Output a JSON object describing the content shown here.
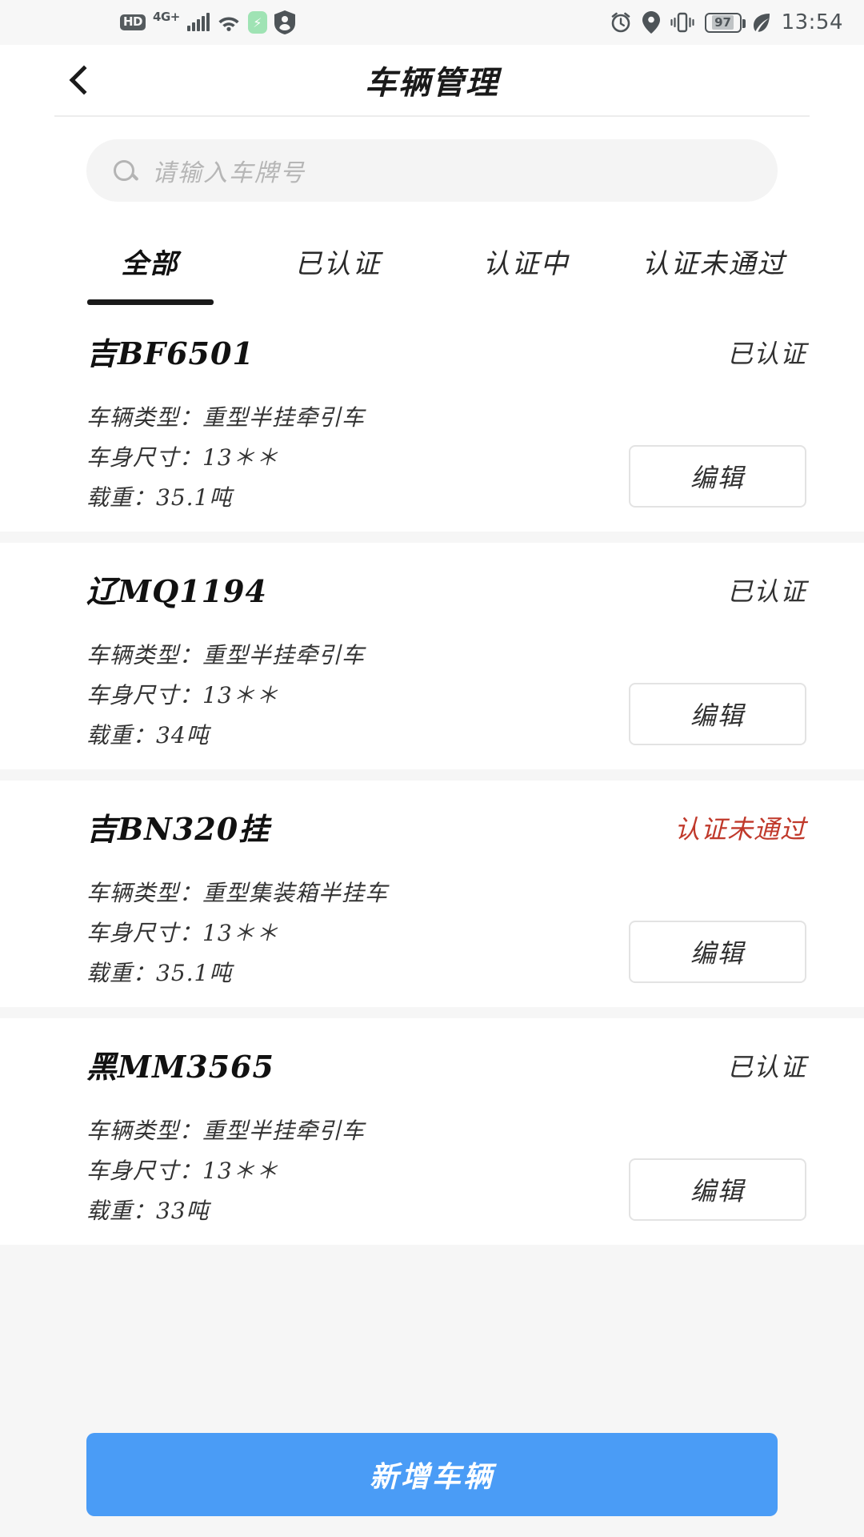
{
  "statusbar": {
    "hd_label": "HD",
    "network_label": "4G+",
    "battery_level": "97",
    "time": "13:54",
    "icons": [
      "hd-icon",
      "4g-plus-icon",
      "signal-bars-icon",
      "wifi-icon",
      "charging-shield-icon",
      "account-shield-icon",
      "alarm-clock-icon",
      "location-pin-icon",
      "vibrate-icon",
      "battery-icon",
      "eco-leaf-icon"
    ]
  },
  "nav": {
    "back_icon": "back-chevron-icon",
    "title": "车辆管理"
  },
  "search": {
    "icon": "search-icon",
    "placeholder": "请输入车牌号",
    "value": ""
  },
  "tabs": [
    {
      "label": "全部",
      "active": true
    },
    {
      "label": "已认证",
      "active": false
    },
    {
      "label": "认证中",
      "active": false
    },
    {
      "label": "认证未通过",
      "active": false
    }
  ],
  "labels": {
    "vehicle_type": "车辆类型：",
    "body_size": "车身尺寸：",
    "load": "载重："
  },
  "colors": {
    "status_verified": "#333333",
    "status_rejected": "#c0392b",
    "primary_button": "#4a9cf6",
    "accent_underline": "#1a1a1a"
  },
  "vehicles": [
    {
      "plate": "吉BF6501",
      "status": "已认证",
      "status_type": "verified",
      "vehicle_type": "车辆类型：重型半挂牵引车",
      "body_size": "车身尺寸：13＊＊",
      "load": "载重：35.1吨",
      "edit_label": "编辑"
    },
    {
      "plate": "辽MQ1194",
      "status": "已认证",
      "status_type": "verified",
      "vehicle_type": "车辆类型：重型半挂牵引车",
      "body_size": "车身尺寸：13＊＊",
      "load": "载重：34吨",
      "edit_label": "编辑"
    },
    {
      "plate": "吉BN320挂",
      "status": "认证未通过",
      "status_type": "rejected",
      "vehicle_type": "车辆类型：重型集装箱半挂车",
      "body_size": "车身尺寸：13＊＊",
      "load": "载重：35.1吨",
      "edit_label": "编辑"
    },
    {
      "plate": "黑MM3565",
      "status": "已认证",
      "status_type": "verified",
      "vehicle_type": "车辆类型：重型半挂牵引车",
      "body_size": "车身尺寸：13＊＊",
      "load": "载重：33吨",
      "edit_label": "编辑"
    }
  ],
  "bottom": {
    "add_vehicle_label": "新增车辆"
  }
}
